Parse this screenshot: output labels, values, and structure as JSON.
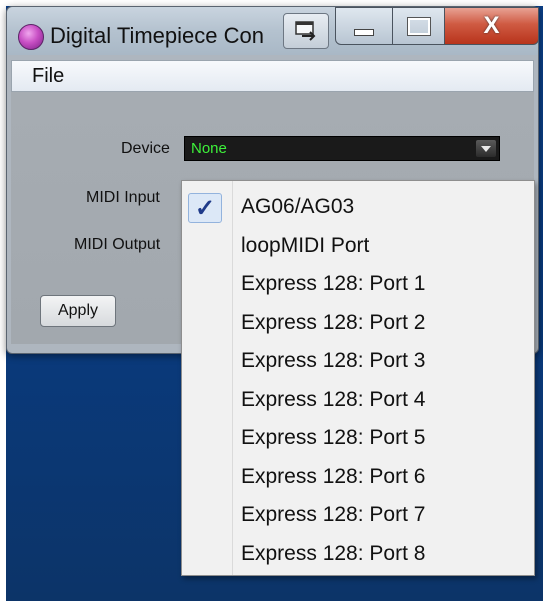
{
  "window": {
    "title": "Digital Timepiece Con"
  },
  "menu": {
    "file": "File"
  },
  "form": {
    "device_label": "Device",
    "device_value": "None",
    "midi_input_label": "MIDI Input",
    "midi_output_label": "MIDI Output",
    "apply_label": "Apply"
  },
  "dropdown": {
    "checked_index": 0,
    "items": [
      {
        "label": "AG06/AG03"
      },
      {
        "label": "loopMIDI Port"
      },
      {
        "label": "Express  128: Port 1"
      },
      {
        "label": "Express  128: Port 2"
      },
      {
        "label": "Express  128: Port 3"
      },
      {
        "label": "Express  128: Port 4"
      },
      {
        "label": "Express  128: Port 5"
      },
      {
        "label": "Express  128: Port 6"
      },
      {
        "label": "Express  128: Port 7"
      },
      {
        "label": "Express  128: Port 8"
      }
    ]
  },
  "icons": {
    "close": "X",
    "checkmark": "✓"
  },
  "colors": {
    "device_value": "#3df13a",
    "close_button": "#cf5a42",
    "desktop": "#0b3f86"
  }
}
